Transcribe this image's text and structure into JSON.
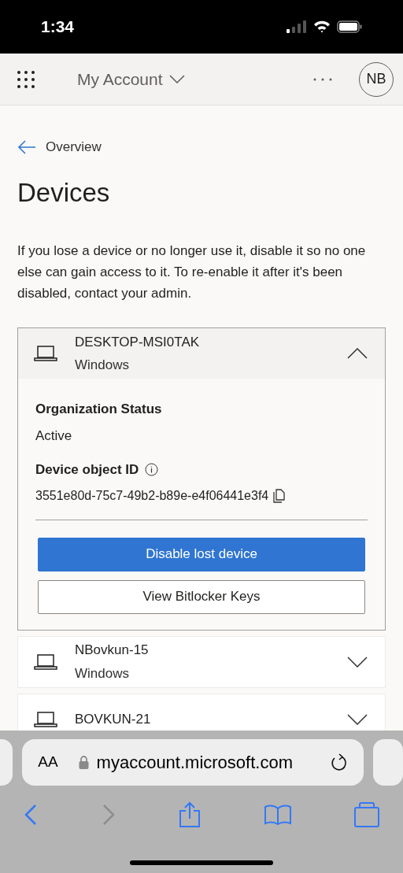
{
  "status_bar": {
    "time": "1:34"
  },
  "header": {
    "title": "My Account",
    "avatar": "NB"
  },
  "back_link": "Overview",
  "page_title": "Devices",
  "intro": "If you lose a device or no longer use it, disable it so no one else can gain access to it. To re-enable it after it's been disabled, contact your admin.",
  "devices": [
    {
      "name": "DESKTOP-MSI0TAK",
      "os": "Windows",
      "expanded": true,
      "details": [
        {
          "kind": "text",
          "label": "Organization Status",
          "value": "Active"
        },
        {
          "kind": "id",
          "label": "Device object ID",
          "value": "3551e80d-75c7-49b2-b89e-e4f06441e3f4"
        }
      ],
      "actions": [
        {
          "kind": "primary",
          "label": "Disable lost device"
        },
        {
          "kind": "secondary",
          "label": "View Bitlocker Keys"
        }
      ]
    },
    {
      "name": "NBovkun-15",
      "os": "Windows",
      "expanded": false
    },
    {
      "name": "BOVKUN-21",
      "expanded": false
    }
  ],
  "browser": {
    "text_size": "AA",
    "url": "myaccount.microsoft.com"
  }
}
